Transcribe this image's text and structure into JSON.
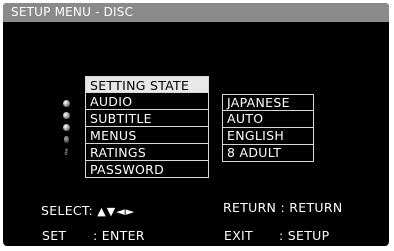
{
  "title": "SETUP MENU - DISC",
  "menu": {
    "header": "SETTING STATE",
    "items": [
      "AUDIO",
      "SUBTITLE",
      "MENUS",
      "RATINGS",
      "PASSWORD"
    ],
    "icons": [
      "disc-icon",
      "disc-icon",
      "disc-icon",
      "lock-icon",
      "key-icon"
    ]
  },
  "values": [
    "JAPANESE",
    "AUTO",
    "ENGLISH",
    "8  ADULT"
  ],
  "footer": {
    "select_label": "SELECT:",
    "select_arrows": "▲▼◄►",
    "return_label": "RETURN : RETURN",
    "set_label": "SET",
    "set_value": ": ENTER",
    "exit_label": "EXIT",
    "exit_value": ": SETUP"
  },
  "colors": {
    "screen_bg": "#000000",
    "title_bar": "#8a8a8a",
    "highlight": "#e8e8e8",
    "text": "#ffffff"
  }
}
